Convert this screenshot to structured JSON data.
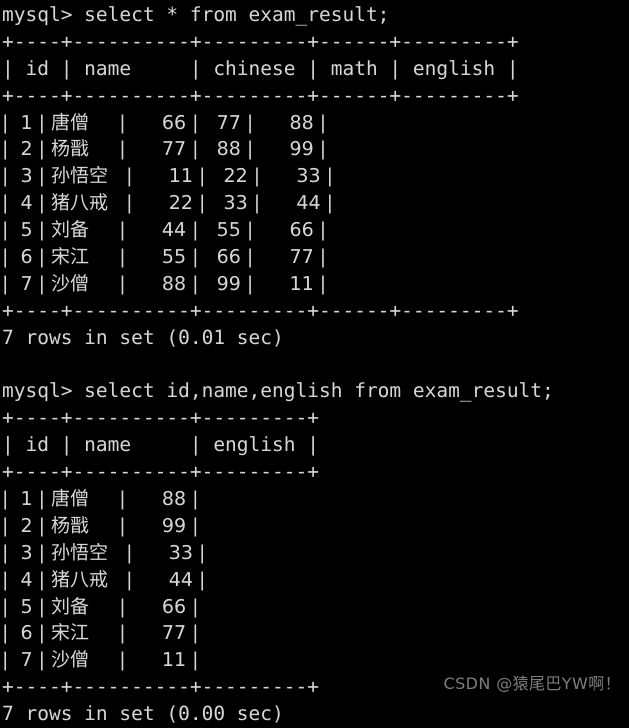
{
  "terminal": {
    "background_color": "#000000",
    "text_color": "#d6d6d6",
    "prompt": "mysql>"
  },
  "watermark": {
    "text": "CSDN @猿尾巴YW啊！",
    "color": "#7d7d7d"
  },
  "queries": [
    {
      "prompt_line": "mysql> select * from exam_result;",
      "sql": "select * from exam_result;",
      "separator": "+----+----------+---------+------+---------+",
      "header_line": "| id | name     | chinese | math | english |",
      "columns": [
        "id",
        "name",
        "chinese",
        "math",
        "english"
      ],
      "rows": [
        "|  1 | 唐僧     |      66 |   77 |      88 |",
        "|  2 | 杨戬     |      77 |   88 |      99 |",
        "|  3 | 孙悟空   |      11 |   22 |      33 |",
        "|  4 | 猪八戒   |      22 |   33 |      44 |",
        "|  5 | 刘备     |      44 |   55 |      66 |",
        "|  6 | 宋江     |      55 |   66 |      77 |",
        "|  7 | 沙僧     |      88 |   99 |      11 |"
      ],
      "row_values": [
        {
          "id": "1",
          "name": "唐僧",
          "chinese": "66",
          "math": "77",
          "english": "88"
        },
        {
          "id": "2",
          "name": "杨戬",
          "chinese": "77",
          "math": "88",
          "english": "99"
        },
        {
          "id": "3",
          "name": "孙悟空",
          "chinese": "11",
          "math": "22",
          "english": "33"
        },
        {
          "id": "4",
          "name": "猪八戒",
          "chinese": "22",
          "math": "33",
          "english": "44"
        },
        {
          "id": "5",
          "name": "刘备",
          "chinese": "44",
          "math": "55",
          "english": "66"
        },
        {
          "id": "6",
          "name": "宋江",
          "chinese": "55",
          "math": "66",
          "english": "77"
        },
        {
          "id": "7",
          "name": "沙僧",
          "chinese": "88",
          "math": "99",
          "english": "11"
        }
      ],
      "status": "7 rows in set (0.01 sec)"
    },
    {
      "prompt_line": "mysql> select id,name,english from exam_result;",
      "sql": "select id,name,english from exam_result;",
      "separator": "+----+----------+---------+",
      "header_line": "| id | name     | english |",
      "columns": [
        "id",
        "name",
        "english"
      ],
      "rows": [
        "|  1 | 唐僧     |      88 |",
        "|  2 | 杨戬     |      99 |",
        "|  3 | 孙悟空   |      33 |",
        "|  4 | 猪八戒   |      44 |",
        "|  5 | 刘备     |      66 |",
        "|  6 | 宋江     |      77 |",
        "|  7 | 沙僧     |      11 |"
      ],
      "row_values": [
        {
          "id": "1",
          "name": "唐僧",
          "english": "88"
        },
        {
          "id": "2",
          "name": "杨戬",
          "english": "99"
        },
        {
          "id": "3",
          "name": "孙悟空",
          "english": "33"
        },
        {
          "id": "4",
          "name": "猪八戒",
          "english": "44"
        },
        {
          "id": "5",
          "name": "刘备",
          "english": "66"
        },
        {
          "id": "6",
          "name": "宋江",
          "english": "77"
        },
        {
          "id": "7",
          "name": "沙僧",
          "english": "11"
        }
      ],
      "status": "7 rows in set (0.00 sec)"
    }
  ],
  "blank_line": " "
}
